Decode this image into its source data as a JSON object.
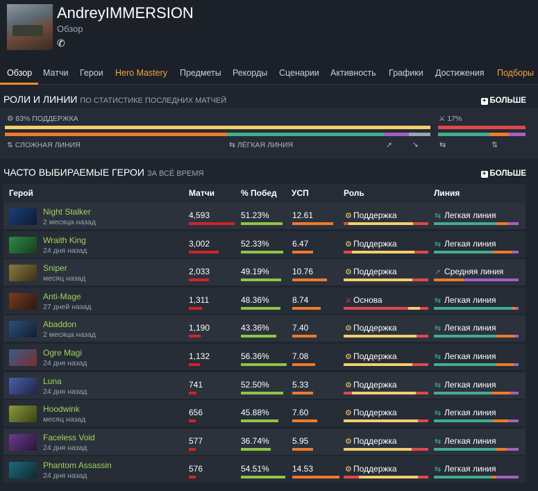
{
  "profile": {
    "name": "AndreyIMMERSION",
    "subtitle": "Обзор",
    "phone_icon": "phone-icon"
  },
  "nav": [
    {
      "label": "Обзор",
      "active": true
    },
    {
      "label": "Матчи"
    },
    {
      "label": "Герои"
    },
    {
      "label": "Hero Mastery",
      "highlight": true
    },
    {
      "label": "Предметы"
    },
    {
      "label": "Рекорды"
    },
    {
      "label": "Сценарии"
    },
    {
      "label": "Активность"
    },
    {
      "label": "Графики"
    },
    {
      "label": "Достижения"
    },
    {
      "label": "Подборы",
      "highlight": true
    }
  ],
  "roles": {
    "title": "РОЛИ И ЛИНИИ",
    "subtitle": "ПО СТАТИСТИКЕ ПОСЛЕДНИХ МАТЧЕЙ",
    "more": "БОЛЬШЕ",
    "support_label": "83% ПОДДЕРЖКА",
    "core_label": "17%",
    "hard_lane": "СЛОЖНАЯ ЛИНИЯ",
    "easy_lane": "ЛЁГКАЯ ЛИНИЯ",
    "support_fraction": 0.83,
    "core_fraction": 0.17
  },
  "heroes": {
    "title": "ЧАСТО ВЫБИРАЕМЫЕ ГЕРОИ",
    "subtitle": "ЗА ВСЁ ВРЕМЯ",
    "more": "БОЛЬШЕ",
    "columns": [
      "Герой",
      "Матчи",
      "% Побед",
      "УСП",
      "Роль",
      "Линия"
    ],
    "rows": [
      {
        "name": "Night Stalker",
        "date": "2 месяца назад",
        "matches": "4,593",
        "winrate": "51.23%",
        "kda": "12.61",
        "role": "Поддержка",
        "lane": "Легкая линия"
      },
      {
        "name": "Wraith King",
        "date": "24 дня назад",
        "matches": "3,002",
        "winrate": "52.33%",
        "kda": "6.47",
        "role": "Поддержка",
        "lane": "Легкая линия"
      },
      {
        "name": "Sniper",
        "date": "месяц назад",
        "matches": "2,033",
        "winrate": "49.19%",
        "kda": "10.76",
        "role": "Поддержка",
        "lane": "Средняя линия"
      },
      {
        "name": "Anti-Mage",
        "date": "27 дней назад",
        "matches": "1,311",
        "winrate": "48.36%",
        "kda": "8.74",
        "role": "Основа",
        "lane": "Легкая линия"
      },
      {
        "name": "Abaddon",
        "date": "2 месяца назад",
        "matches": "1,190",
        "winrate": "43.36%",
        "kda": "7.40",
        "role": "Поддержка",
        "lane": "Легкая линия"
      },
      {
        "name": "Ogre Magi",
        "date": "24 дня назад",
        "matches": "1,132",
        "winrate": "56.36%",
        "kda": "7.08",
        "role": "Поддержка",
        "lane": "Легкая линия"
      },
      {
        "name": "Luna",
        "date": "24 дня назад",
        "matches": "741",
        "winrate": "52.50%",
        "kda": "5.33",
        "role": "Поддержка",
        "lane": "Легкая линия"
      },
      {
        "name": "Hoodwink",
        "date": "месяц назад",
        "matches": "656",
        "winrate": "45.88%",
        "kda": "7.60",
        "role": "Поддержка",
        "lane": "Легкая линия"
      },
      {
        "name": "Faceless Void",
        "date": "24 дня назад",
        "matches": "577",
        "winrate": "36.74%",
        "kda": "5.95",
        "role": "Поддержка",
        "lane": "Легкая линия"
      },
      {
        "name": "Phantom Assassin",
        "date": "24 дня назад",
        "matches": "576",
        "winrate": "54.51%",
        "kda": "14.53",
        "role": "Поддержка",
        "lane": "Легкая линия"
      }
    ]
  },
  "colors": {
    "support": "#f2cf6d",
    "core": "#e0474c",
    "safe_lane": "#42ad8f",
    "off_lane": "#f07a2b",
    "mid_lane": "#a65fc2",
    "matches_bar": "#d0242b",
    "winrate_bar": "#8fc547",
    "kda_bar": "#f07a2b"
  }
}
